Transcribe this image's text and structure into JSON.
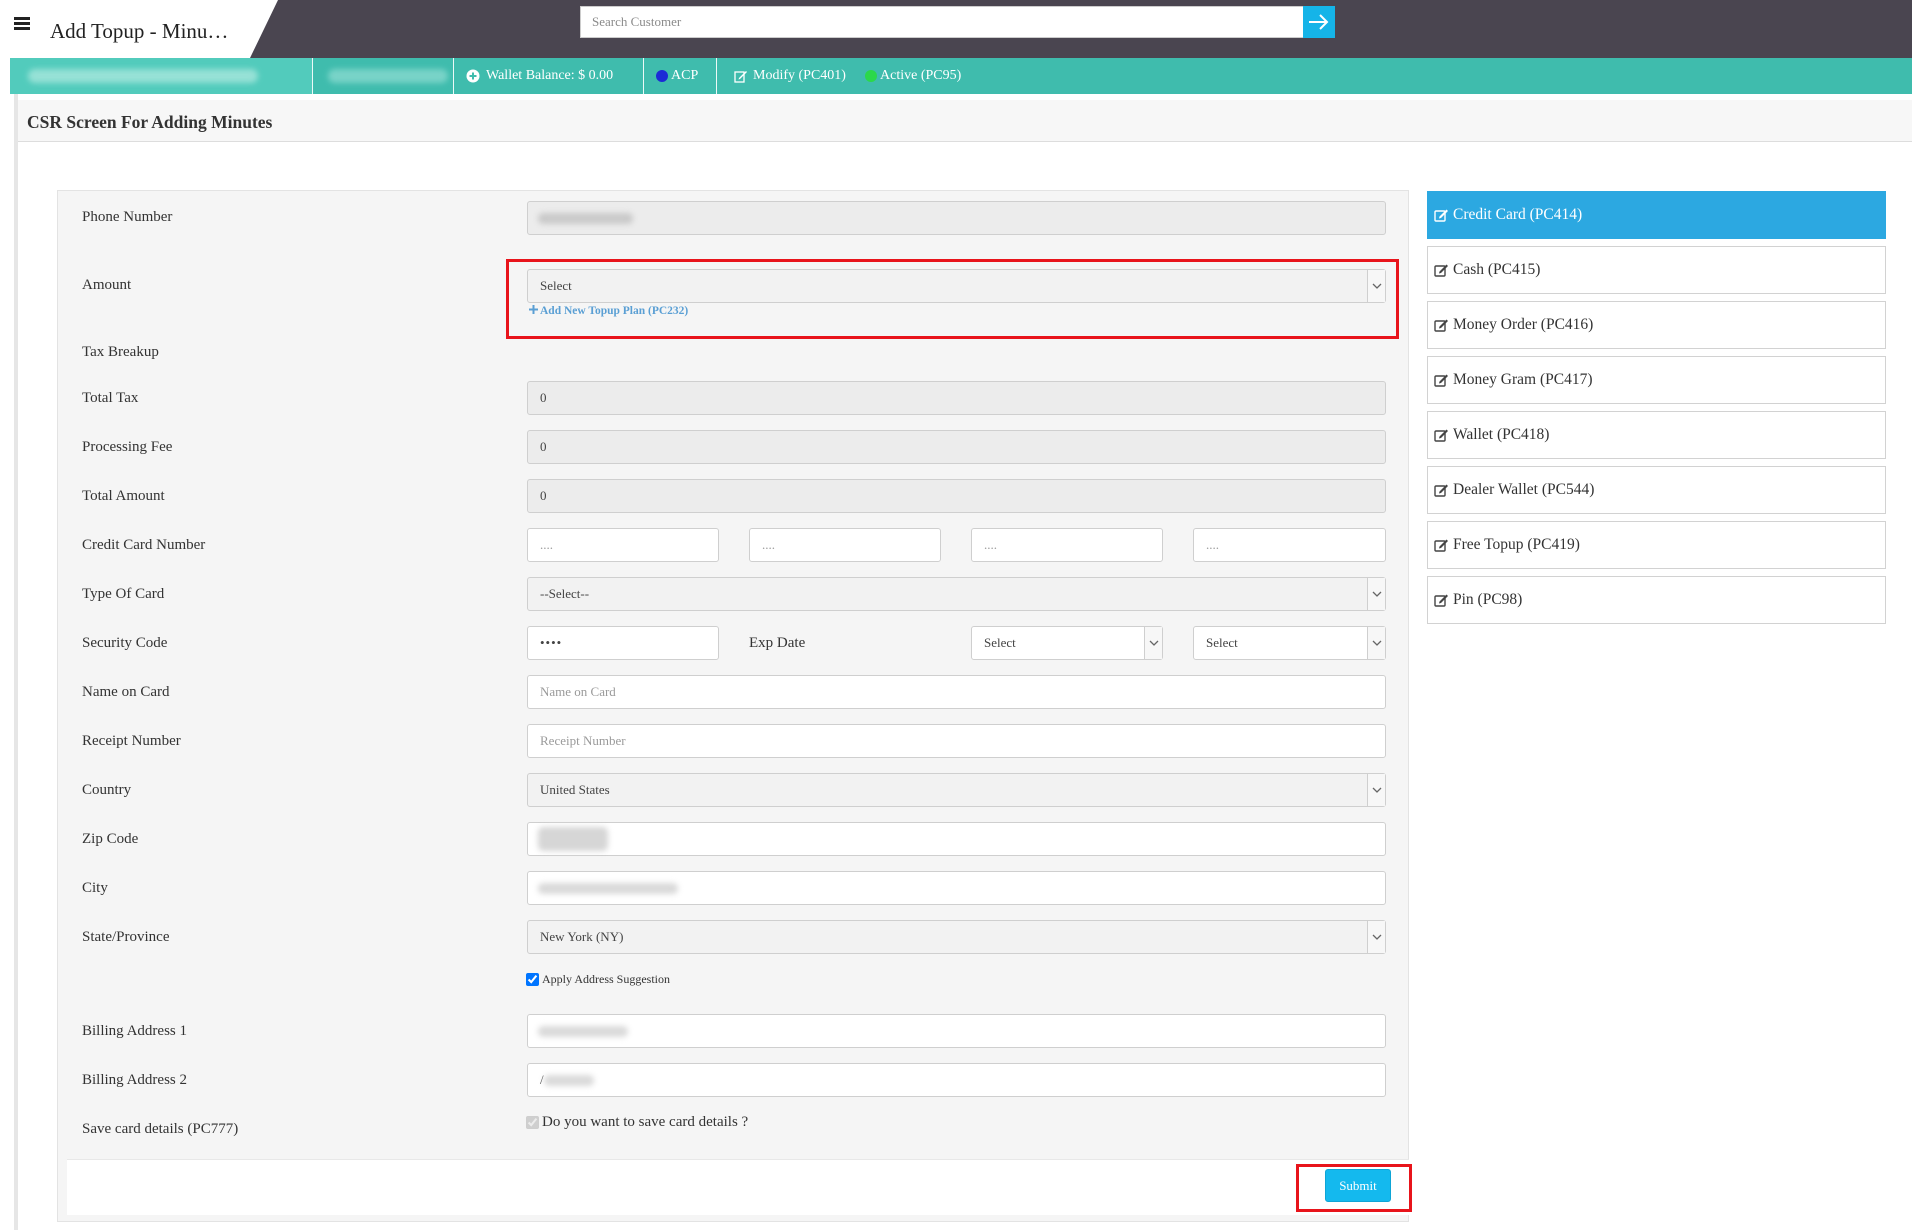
{
  "header": {
    "title": "Add Topup - Minu…",
    "search_placeholder": "Search Customer"
  },
  "status_strip": {
    "wallet_balance": "Wallet Balance: $ 0.00",
    "acp": "ACP",
    "modify": "Modify (PC401)",
    "active": "Active (PC95)"
  },
  "page": {
    "heading": "CSR Screen For Adding Minutes"
  },
  "form": {
    "labels": {
      "phone": "Phone Number",
      "amount": "Amount",
      "tax_breakup": "Tax Breakup",
      "total_tax": "Total Tax",
      "processing_fee": "Processing Fee",
      "total_amount": "Total Amount",
      "card_number": "Credit Card Number",
      "card_type": "Type Of Card",
      "security_code": "Security Code",
      "exp_date": "Exp Date",
      "name_on_card": "Name on Card",
      "receipt_number": "Receipt Number",
      "country": "Country",
      "zip": "Zip Code",
      "city": "City",
      "state": "State/Province",
      "billing1": "Billing Address 1",
      "billing2": "Billing Address 2",
      "save_card": "Save card details (PC777)"
    },
    "amount_select": "Select",
    "add_topup_link": "Add New Topup Plan (PC232)",
    "total_tax": "0",
    "processing_fee": "0",
    "total_amount": "0",
    "card_placeholder": "....",
    "card_type_select": "--Select--",
    "security_code": "••••",
    "exp_month_select": "Select",
    "exp_year_select": "Select",
    "name_placeholder": "Name on Card",
    "receipt_placeholder": "Receipt Number",
    "country_select": "United States",
    "state_select": "New York (NY)",
    "apply_address": "Apply Address Suggestion",
    "billing2_value": "/",
    "save_card_question": "Do you want to save card details ?",
    "submit": "Submit"
  },
  "payment_methods": [
    {
      "label": "Credit Card (PC414)",
      "active": true
    },
    {
      "label": "Cash (PC415)",
      "active": false
    },
    {
      "label": "Money Order (PC416)",
      "active": false
    },
    {
      "label": "Money Gram (PC417)",
      "active": false
    },
    {
      "label": "Wallet (PC418)",
      "active": false
    },
    {
      "label": "Dealer Wallet (PC544)",
      "active": false
    },
    {
      "label": "Free Topup (PC419)",
      "active": false
    },
    {
      "label": "Pin (PC98)",
      "active": false
    }
  ],
  "colors": {
    "topbar": "#4a4550",
    "strip": "#3fbcad",
    "accent": "#2ca8e1",
    "highlight": "#e8141b",
    "acp_dot": "#1c2bd6",
    "active_dot": "#2bd84a"
  }
}
